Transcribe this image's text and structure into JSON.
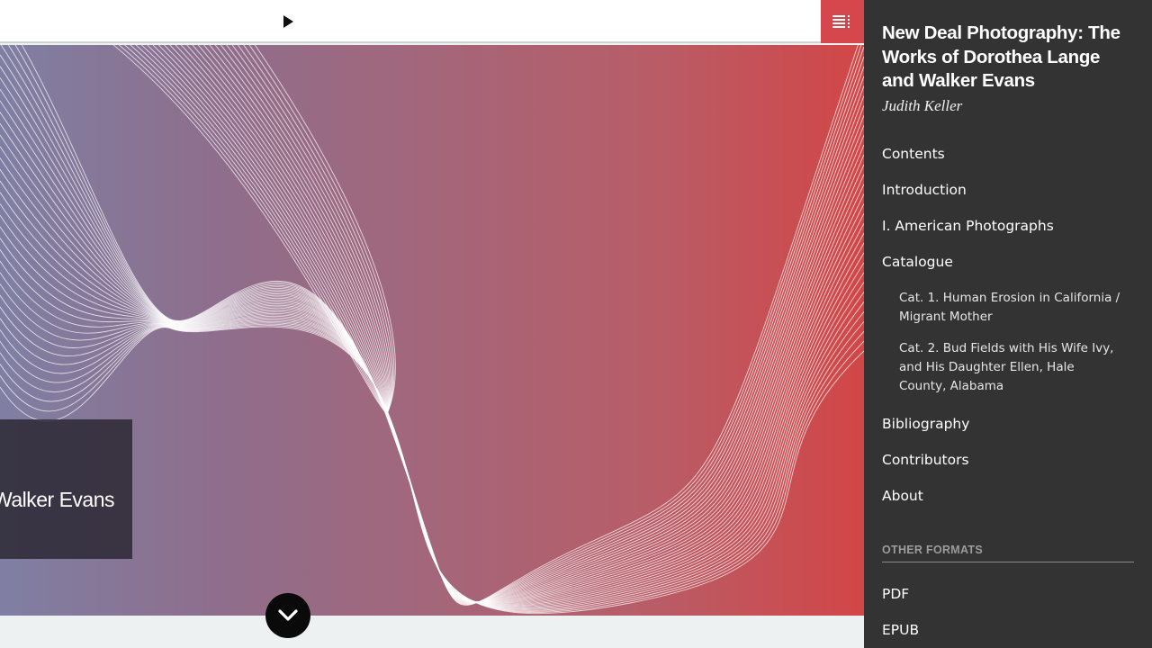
{
  "navbar": {
    "play_icon": "play-icon",
    "menu_icon": "menu-list-icon",
    "accent": "#d6474d"
  },
  "hero": {
    "title_fragment": "l Walker Evans",
    "scroll_icon": "chevron-down-icon",
    "gradient": [
      "#7f7fa3",
      "#8e6e8c",
      "#a4667a",
      "#b85d68",
      "#d24646"
    ]
  },
  "sidebar": {
    "title": "New Deal Photography: The Works of Dorothea Lange and Walker Evans",
    "author": "Judith Keller",
    "toc": [
      {
        "label": "Contents"
      },
      {
        "label": "Introduction"
      },
      {
        "label": "I. American Photographs"
      },
      {
        "label": "Catalogue"
      }
    ],
    "catalogue_items": [
      {
        "label": "Cat. 1. Human Erosion in California / Migrant Mother"
      },
      {
        "label": "Cat. 2. Bud Fields with His Wife Ivy, and His Daughter Ellen, Hale County, Alabama"
      }
    ],
    "toc_after": [
      {
        "label": "Bibliography"
      },
      {
        "label": "Contributors"
      },
      {
        "label": "About"
      }
    ],
    "formats_heading": "OTHER FORMATS",
    "formats": [
      {
        "label": "PDF"
      },
      {
        "label": "EPUB"
      }
    ],
    "background": "#333333"
  }
}
